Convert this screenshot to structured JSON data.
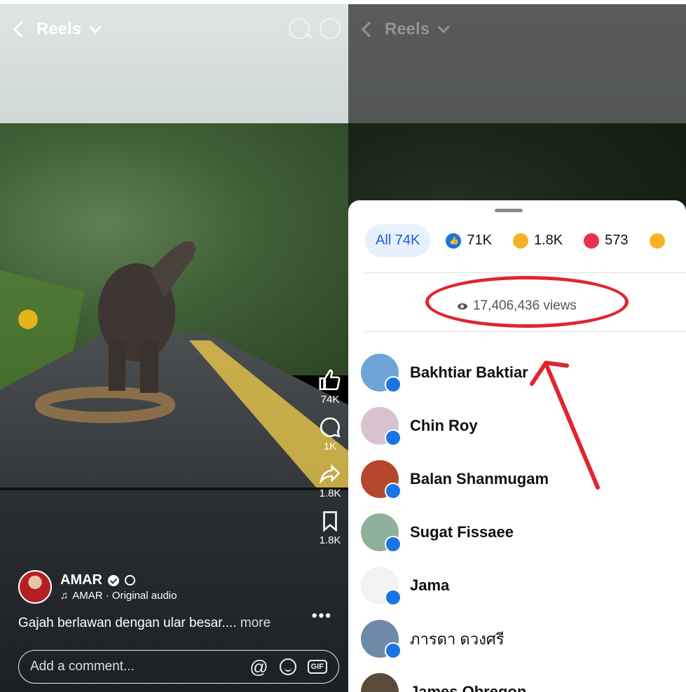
{
  "left": {
    "title": "Reels",
    "author": {
      "name": "AMAR",
      "audio": "AMAR · Original audio"
    },
    "caption": {
      "text": "Gajah berlawan dengan ular besar.... ",
      "more": "more"
    },
    "comment": {
      "placeholder": "Add a comment..."
    },
    "actions": {
      "likes": "74K",
      "comments": "1K",
      "shares": "1.8K",
      "saves": "1.8K"
    }
  },
  "right": {
    "title": "Reels",
    "tabs": {
      "all": "All 74K",
      "like": "71K",
      "wow": "1.8K",
      "love": "573"
    },
    "views": "17,406,436 views",
    "people": [
      {
        "name": "Bakhtiar Baktiar",
        "avatar_color": "#6fa4d8"
      },
      {
        "name": "Chin Roy",
        "avatar_color": "#d9c2cf"
      },
      {
        "name": "Balan Shanmugam",
        "avatar_color": "#b4472b"
      },
      {
        "name": "Sugat Fissaee",
        "avatar_color": "#8fb09a"
      },
      {
        "name": "Jama",
        "avatar_color": "#f2f2f2"
      },
      {
        "name": "ภารดา ดวงศรี",
        "avatar_color": "#6e8aa8"
      },
      {
        "name": "James Obregon",
        "avatar_color": "#5a4a3a"
      }
    ]
  },
  "colors": {
    "accent": "#1b74e4",
    "annotation": "#e0252d"
  }
}
